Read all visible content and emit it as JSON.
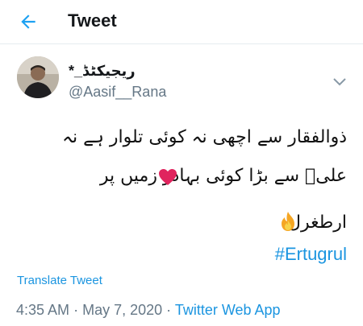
{
  "header": {
    "title": "Tweet"
  },
  "author": {
    "display_name": "ریجیکٹڈ_*",
    "username": "@Aasif__Rana"
  },
  "tweet": {
    "lines": [
      "ذوالفقار سے اچھی نہ کوئی تلوار ہے نہ",
      "علیؓ سے بڑا کوئی بہادر زمیں پر",
      "ارطغرل"
    ],
    "hashtag": "#Ertugrul",
    "emoji": {
      "line2": "heart-emoji",
      "line3": "fire-emoji"
    }
  },
  "actions": {
    "translate": "Translate Tweet"
  },
  "meta": {
    "time": "4:35 AM",
    "separator": "·",
    "date": "May 7, 2020",
    "source": "Twitter Web App"
  },
  "colors": {
    "link": "#1b95e0",
    "secondary_text": "#657786",
    "heart": "#e0245e",
    "fire": "#f5a623"
  }
}
